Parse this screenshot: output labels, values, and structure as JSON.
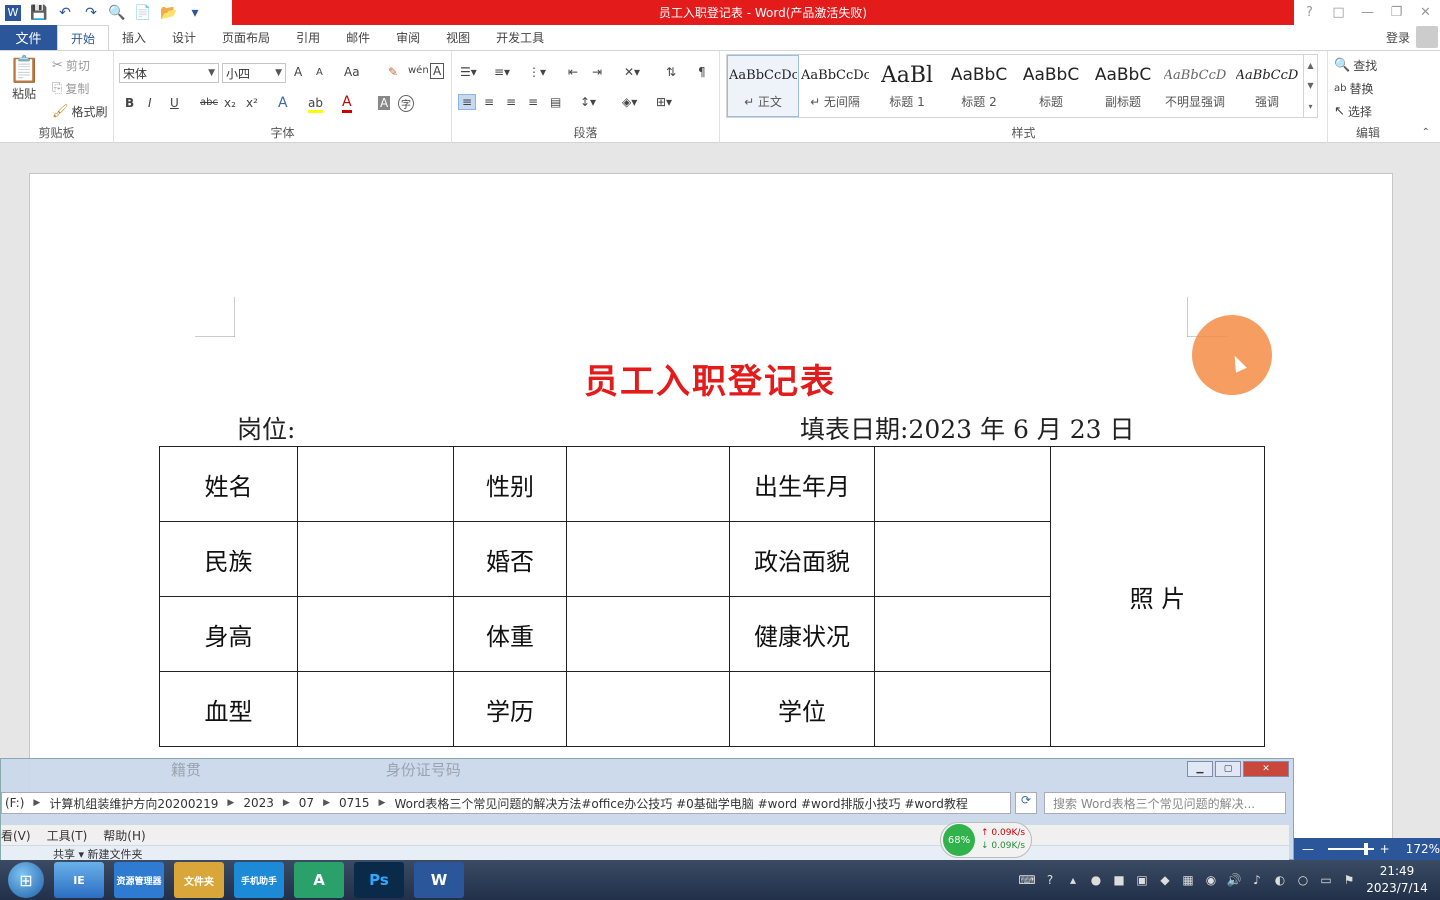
{
  "window": {
    "title": "员工入职登记表 - Word(产品激活失败)",
    "help": "?",
    "restore_ribbon": "□",
    "minimize": "—",
    "maximize": "❐",
    "close": "✕"
  },
  "quick_access": [
    "W",
    "💾",
    "↶",
    "↷",
    "🔍",
    "📄",
    "📂",
    "▾"
  ],
  "tabs": {
    "file": "文件",
    "items": [
      "开始",
      "插入",
      "设计",
      "页面布局",
      "引用",
      "邮件",
      "审阅",
      "视图",
      "开发工具"
    ],
    "active": "开始",
    "login": "登录"
  },
  "ribbon": {
    "clipboard": {
      "label": "剪贴板",
      "paste": "粘贴",
      "cut": "剪切",
      "copy": "复制",
      "format_painter": "格式刷"
    },
    "font": {
      "label": "字体",
      "font_name": "宋体",
      "font_size": "小四",
      "bold": "B",
      "italic": "I",
      "underline": "U",
      "strike": "abc",
      "sub": "x₂",
      "sup": "x²",
      "change_case": "Aa",
      "grow": "A",
      "shrink": "A",
      "wen": "wén",
      "font_color": "A",
      "highlight": "ab",
      "text_effects": "A",
      "char_border": "A",
      "char_shade": "A",
      "enclosed": "字"
    },
    "paragraph": {
      "label": "段落"
    },
    "styles": {
      "label": "样式",
      "items": [
        {
          "preview": "AaBbCcDc",
          "name": "↵ 正文"
        },
        {
          "preview": "AaBbCcDc",
          "name": "↵ 无间隔"
        },
        {
          "preview": "AaBl",
          "name": "标题 1"
        },
        {
          "preview": "AaBbC",
          "name": "标题 2"
        },
        {
          "preview": "AaBbC",
          "name": "标题"
        },
        {
          "preview": "AaBbC",
          "name": "副标题"
        },
        {
          "preview": "AaBbCcD",
          "name": "不明显强调"
        },
        {
          "preview": "AaBbCcD",
          "name": "强调"
        }
      ]
    },
    "editing": {
      "label": "编辑",
      "find": "查找",
      "replace": "替换",
      "select": "选择"
    }
  },
  "document": {
    "title": "员工入职登记表",
    "position_label": "岗位:",
    "date_label": "填表日期:2023 年 6 月 23 日",
    "table": {
      "rows": [
        [
          "姓名",
          "",
          "性别",
          "",
          "出生年月",
          ""
        ],
        [
          "民族",
          "",
          "婚否",
          "",
          "政治面貌",
          ""
        ],
        [
          "身高",
          "",
          "体重",
          "",
          "健康状况",
          ""
        ],
        [
          "血型",
          "",
          "学历",
          "",
          "学位",
          ""
        ]
      ],
      "photo": "照  片"
    }
  },
  "explorer": {
    "drive": "(F:)",
    "path": [
      "计算机组装维护方向20200219",
      "2023",
      "07",
      "0715",
      "Word表格三个常见问题的解决方法#office办公技巧 #0基础学电脑 #word #word排版小技巧 #word教程"
    ],
    "search_placeholder": "搜索 Word表格三个常见问题的解决...",
    "menu": [
      "看(V)",
      "工具(T)",
      "帮助(H)"
    ],
    "toolbar_text": "共享 ▾     新建文件夹",
    "faded_cells": [
      "籍贯",
      "身份证号码"
    ]
  },
  "net_meter": {
    "percent": "68%",
    "up": "↑ 0.09K/s",
    "down": "↓ 0.09K/s"
  },
  "zoom": {
    "minus": "—",
    "plus": "+",
    "level": "172%"
  },
  "taskbar": {
    "apps": [
      "IE",
      "资源管理器",
      "文件夹",
      "手机助手",
      "A",
      "Ps",
      "W"
    ],
    "time": "21:49",
    "date": "2023/7/14"
  }
}
